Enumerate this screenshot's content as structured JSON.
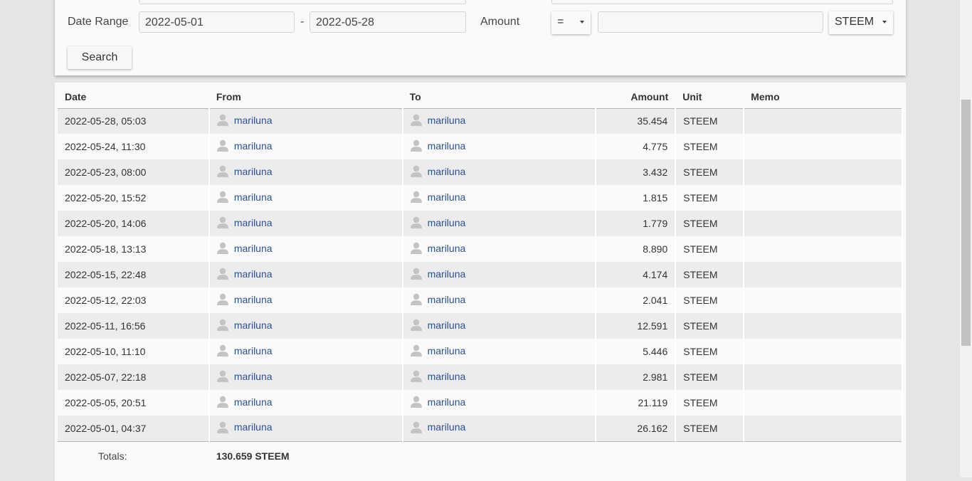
{
  "filter": {
    "date_range_label": "Date Range",
    "date_from": "2022-05-01",
    "date_sep": "-",
    "date_to": "2022-05-28",
    "amount_label": "Amount",
    "amount_operator": "=",
    "amount_value": "",
    "unit": "STEEM",
    "search_label": "Search"
  },
  "table": {
    "headers": {
      "date": "Date",
      "from": "From",
      "to": "To",
      "amount": "Amount",
      "unit": "Unit",
      "memo": "Memo"
    },
    "rows": [
      {
        "date": "2022-05-28, 05:03",
        "from": "mariluna",
        "to": "mariluna",
        "amount": "35.454",
        "unit": "STEEM",
        "memo": ""
      },
      {
        "date": "2022-05-24, 11:30",
        "from": "mariluna",
        "to": "mariluna",
        "amount": "4.775",
        "unit": "STEEM",
        "memo": ""
      },
      {
        "date": "2022-05-23, 08:00",
        "from": "mariluna",
        "to": "mariluna",
        "amount": "3.432",
        "unit": "STEEM",
        "memo": ""
      },
      {
        "date": "2022-05-20, 15:52",
        "from": "mariluna",
        "to": "mariluna",
        "amount": "1.815",
        "unit": "STEEM",
        "memo": ""
      },
      {
        "date": "2022-05-20, 14:06",
        "from": "mariluna",
        "to": "mariluna",
        "amount": "1.779",
        "unit": "STEEM",
        "memo": ""
      },
      {
        "date": "2022-05-18, 13:13",
        "from": "mariluna",
        "to": "mariluna",
        "amount": "8.890",
        "unit": "STEEM",
        "memo": ""
      },
      {
        "date": "2022-05-15, 22:48",
        "from": "mariluna",
        "to": "mariluna",
        "amount": "4.174",
        "unit": "STEEM",
        "memo": ""
      },
      {
        "date": "2022-05-12, 22:03",
        "from": "mariluna",
        "to": "mariluna",
        "amount": "2.041",
        "unit": "STEEM",
        "memo": ""
      },
      {
        "date": "2022-05-11, 16:56",
        "from": "mariluna",
        "to": "mariluna",
        "amount": "12.591",
        "unit": "STEEM",
        "memo": ""
      },
      {
        "date": "2022-05-10, 11:10",
        "from": "mariluna",
        "to": "mariluna",
        "amount": "5.446",
        "unit": "STEEM",
        "memo": ""
      },
      {
        "date": "2022-05-07, 22:18",
        "from": "mariluna",
        "to": "mariluna",
        "amount": "2.981",
        "unit": "STEEM",
        "memo": ""
      },
      {
        "date": "2022-05-05, 20:51",
        "from": "mariluna",
        "to": "mariluna",
        "amount": "21.119",
        "unit": "STEEM",
        "memo": ""
      },
      {
        "date": "2022-05-01, 04:37",
        "from": "mariluna",
        "to": "mariluna",
        "amount": "26.162",
        "unit": "STEEM",
        "memo": ""
      }
    ],
    "totals_label": "Totals:",
    "totals_value": "130.659 STEEM"
  },
  "colors": {
    "link": "#2d4f8f",
    "row_alt": "#ececec",
    "panel": "#fafafa",
    "background": "#e5e5e5"
  },
  "icons": {
    "user": "user-silhouette-icon",
    "caret": "caret-down-icon"
  }
}
